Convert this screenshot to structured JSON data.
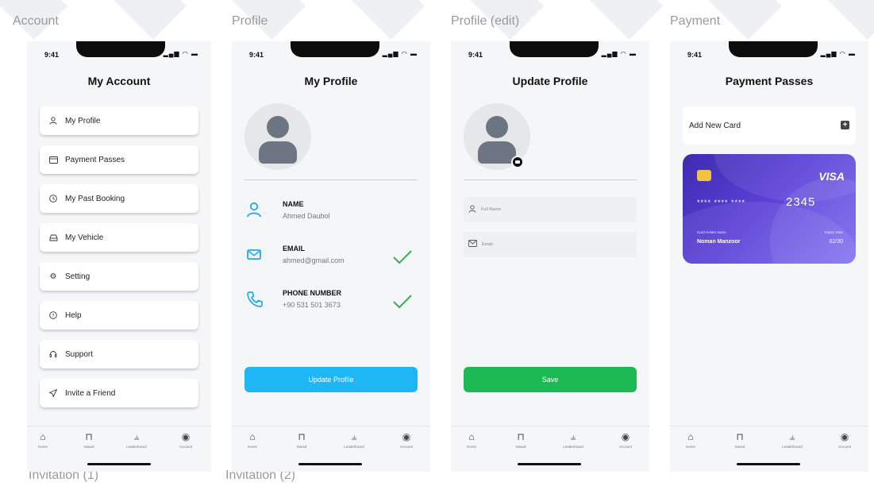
{
  "frames": {
    "account": "Account",
    "profile": "Profile",
    "profile_edit": "Profile (edit)",
    "payment": "Payment",
    "invitation_1": "Invitation (1)",
    "invitation_2": "Invitation (2)"
  },
  "status_bar": {
    "time": "9:41",
    "icons": "signal-wifi-battery"
  },
  "tabbar": {
    "items": [
      {
        "label": "Home",
        "icon": "home-icon"
      },
      {
        "label": "Saved",
        "icon": "bookmark-icon"
      },
      {
        "label": "Leaderboard",
        "icon": "leaderboard-icon"
      },
      {
        "label": "Account",
        "icon": "account-icon"
      }
    ]
  },
  "account": {
    "title": "My Account",
    "menu": [
      {
        "label": "My Profile",
        "icon": "user-icon"
      },
      {
        "label": "Payment Passes",
        "icon": "card-icon"
      },
      {
        "label": "My Past Booking",
        "icon": "clock-icon"
      },
      {
        "label": "My Vehicle",
        "icon": "car-icon"
      },
      {
        "label": "Setting",
        "icon": "gear-icon"
      },
      {
        "label": "Help",
        "icon": "help-icon"
      },
      {
        "label": "Support",
        "icon": "support-icon"
      },
      {
        "label": "Invite a Friend",
        "icon": "send-icon"
      }
    ]
  },
  "profile": {
    "title": "My Profile",
    "rows": [
      {
        "label": "NAME",
        "value": "Ahmed Daubol",
        "verified": false
      },
      {
        "label": "EMAIL",
        "value": "ahmed@gmail.com",
        "verified": true
      },
      {
        "label": "PHONE NUMBER",
        "value": "+90 531 501 3673",
        "verified": true
      }
    ],
    "button": "Update Profile"
  },
  "profile_edit": {
    "title": "Update Profile",
    "fields": [
      {
        "placeholder": "Full Name",
        "icon": "user-icon"
      },
      {
        "placeholder": "Email",
        "icon": "mail-icon"
      }
    ],
    "button": "Save"
  },
  "payment": {
    "title": "Payment Passes",
    "add_card": "Add New Card",
    "card": {
      "brand": "VISA",
      "number_masked": "**** **** ****",
      "number_last": "2345",
      "holder_label": "Card Holder name",
      "holder_name": "Noman Manzoor",
      "expiry_label": "Expiry Date",
      "expiry": "02/30"
    }
  },
  "colors": {
    "accent_blue": "#1fb6f5",
    "accent_green": "#1db954",
    "card_purple": "#5a3fd6",
    "check_green": "#3aaa5a"
  }
}
